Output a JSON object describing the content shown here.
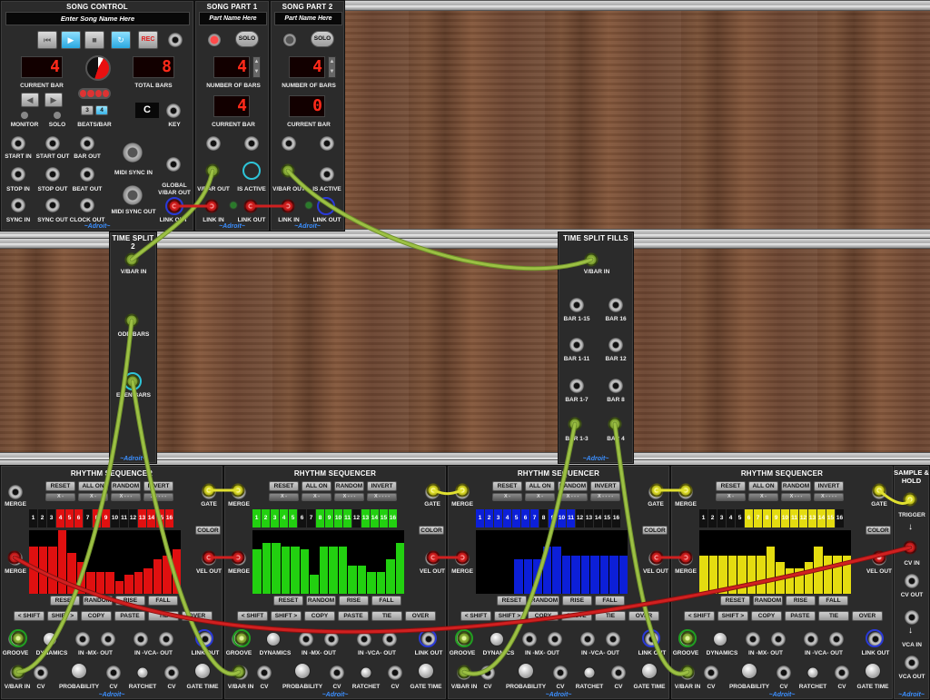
{
  "colors": {
    "cable_green": "#8fb33a",
    "cable_red": "#c41e1e",
    "cable_yellow": "#d8d830",
    "brand": "#3b8fff",
    "seq_red": "#e01010",
    "seq_green": "#22d010",
    "seq_blue": "#0c1fd8",
    "seq_yellow": "#e4dc10"
  },
  "song_control": {
    "title": "SONG CONTROL",
    "name_placeholder": "Enter Song Name Here",
    "rec": "REC",
    "current_bar_value": "4",
    "current_bar_label": "CURRENT BAR",
    "total_bars_value": "8",
    "total_bars_label": "TOTAL BARS",
    "monitor": "MONITOR",
    "solo": "SOLO",
    "beats_bar": "BEATS/BAR",
    "beats_3": "3",
    "beats_4": "4",
    "key_value": "C",
    "key_label": "KEY",
    "start_in": "START IN",
    "start_out": "START OUT",
    "bar_out": "BAR OUT",
    "stop_in": "STOP IN",
    "stop_out": "STOP OUT",
    "beat_out": "BEAT OUT",
    "sync_in": "SYNC IN",
    "sync_out": "SYNC OUT",
    "clock_out": "CLOCK OUT",
    "midi_sync_in": "MIDI SYNC IN",
    "global_vbar_out": "GLOBAL V/BAR OUT",
    "midi_sync_out": "MIDI SYNC OUT",
    "brand": "~Adroit~"
  },
  "song_part_1": {
    "title": "SONG PART 1",
    "name": "Part Name Here",
    "solo": "SOLO",
    "num_bars_value": "4",
    "num_bars_label": "NUMBER OF BARS",
    "current_bar_value": "4",
    "current_bar_label": "CURRENT BAR",
    "vbar_out": "V/BAR OUT",
    "is_active": "IS ACTIVE",
    "link_in": "LINK IN",
    "link_out": "LINK OUT",
    "brand": "~Adroit~"
  },
  "song_part_2": {
    "title": "SONG PART 2",
    "name": "Part Name Here",
    "solo": "SOLO",
    "num_bars_value": "4",
    "num_bars_label": "NUMBER OF BARS",
    "current_bar_value": "0",
    "current_bar_label": "CURRENT BAR",
    "vbar_out": "V/BAR OUT",
    "is_active": "IS ACTIVE",
    "link_in": "LINK IN",
    "link_out": "LINK OUT",
    "brand": "~Adroit~"
  },
  "time_split_2": {
    "title": "TIME SPLIT 2",
    "vbar_in": "V/BAR IN",
    "odd_bars": "ODD BARS",
    "even_bars": "EVEN BARS",
    "brand": "~Adroit~"
  },
  "time_split_fills": {
    "title": "TIME SPLIT FILLS",
    "vbar_in": "V/BAR IN",
    "bar_1_15": "BAR 1-15",
    "bar_16": "BAR 16",
    "bar_1_11": "BAR 1-11",
    "bar_12": "BAR 12",
    "bar_1_7": "BAR 1-7",
    "bar_8": "BAR 8",
    "bar_1_3": "BAR 1-3",
    "bar_4": "BAR 4",
    "brand": "~Adroit~"
  },
  "rhythm_seq": {
    "title": "RHYTHM SEQUENCER",
    "reset": "RESET",
    "all_on": "ALL ON",
    "random": "RANDOM",
    "invert": "INVERT",
    "x_dash": "X -",
    "x_dash2": "X - - -",
    "x_dash3": "X - - - -",
    "merge": "MERGE",
    "gate": "GATE",
    "color": "COLOR",
    "vel_out": "VEL OUT",
    "reset2": "RESET",
    "random2": "RANDOM",
    "rise": "RISE",
    "fall": "FALL",
    "shift_l": "< SHIFT",
    "shift_r": "SHIFT >",
    "copy": "COPY",
    "paste": "PASTE",
    "tie": "TIE",
    "over": "OVER",
    "groove": "GROOVE",
    "dynamics": "DYNAMICS",
    "in_mx_out": "IN -MX- OUT",
    "in_vca_out": "IN -VCA- OUT",
    "link_out": "LINK OUT",
    "vbar_in": "V/BAR IN",
    "cv": "CV",
    "probability": "PROBABILITY",
    "ratchet": "RATCHET",
    "gate_time": "GATE TIME",
    "brand": "~Adroit~",
    "step_numbers": [
      "1",
      "2",
      "3",
      "4",
      "5",
      "6",
      "7",
      "8",
      "9",
      "10",
      "11",
      "12",
      "13",
      "14",
      "15",
      "16"
    ]
  },
  "sequencers": [
    {
      "color": "#e01010",
      "active": [
        0,
        0,
        0,
        1,
        1,
        1,
        0,
        1,
        1,
        0,
        0,
        0,
        1,
        1,
        1,
        1
      ],
      "levels": [
        0.75,
        0.75,
        0.75,
        1.0,
        0.65,
        0.5,
        0.35,
        0.35,
        0.35,
        0.2,
        0.3,
        0.35,
        0.4,
        0.55,
        0.6,
        0.7
      ]
    },
    {
      "color": "#22d010",
      "active": [
        1,
        1,
        1,
        1,
        1,
        0,
        0,
        1,
        1,
        1,
        1,
        0,
        1,
        1,
        1,
        1
      ],
      "levels": [
        0.7,
        0.8,
        0.8,
        0.75,
        0.75,
        0.7,
        0.3,
        0.75,
        0.75,
        0.75,
        0.45,
        0.45,
        0.35,
        0.35,
        0.55,
        0.8
      ]
    },
    {
      "color": "#0c1fd8",
      "active": [
        1,
        1,
        1,
        1,
        1,
        1,
        1,
        0,
        1,
        1,
        1,
        0,
        0,
        0,
        0,
        0
      ],
      "levels": [
        0,
        0,
        0,
        0,
        0.55,
        0.55,
        0.55,
        0.75,
        0.75,
        0.6,
        0.6,
        0.6,
        0.6,
        0.6,
        0.6,
        0.6
      ]
    },
    {
      "color": "#e4dc10",
      "active": [
        0,
        0,
        0,
        0,
        0,
        1,
        1,
        1,
        1,
        1,
        1,
        1,
        1,
        1,
        1,
        0
      ],
      "levels": [
        0.6,
        0.6,
        0.6,
        0.6,
        0.6,
        0.6,
        0.6,
        0.75,
        0.5,
        0.4,
        0.4,
        0.5,
        0.75,
        0.6,
        0.6,
        0.6
      ]
    }
  ],
  "sample_hold": {
    "title": "SAMPLE & HOLD",
    "trigger": "TRIGGER",
    "cv_in": "CV IN",
    "cv_out": "CV OUT",
    "vca_in": "VCA IN",
    "vca_out": "VCA OUT",
    "brand": "~Adroit~"
  }
}
